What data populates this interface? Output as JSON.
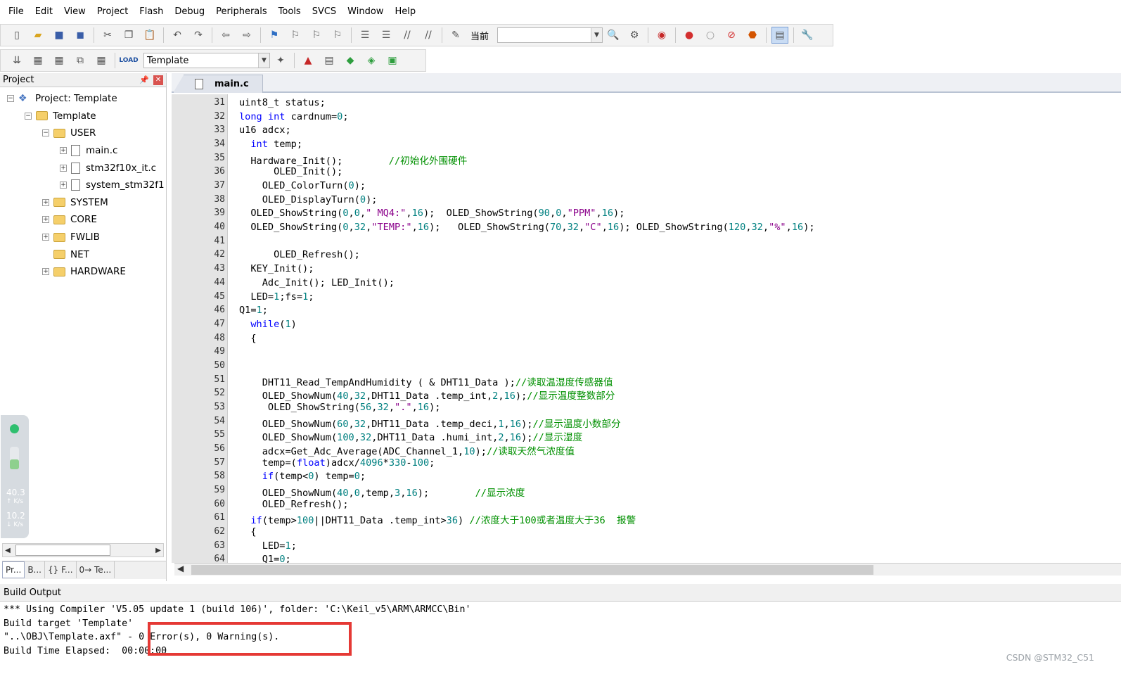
{
  "menu": [
    "File",
    "Edit",
    "View",
    "Project",
    "Flash",
    "Debug",
    "Peripherals",
    "Tools",
    "SVCS",
    "Window",
    "Help"
  ],
  "toolbar1": {
    "current_label": "当前"
  },
  "toolbar2": {
    "target_combo": "Template"
  },
  "project_panel": {
    "title": "Project",
    "tree": [
      {
        "label": "Project: Template",
        "level": 0,
        "kind": "project",
        "expander": "⊟"
      },
      {
        "label": "Template",
        "level": 1,
        "kind": "group",
        "expander": "⊟"
      },
      {
        "label": "USER",
        "level": 2,
        "kind": "folder",
        "expander": "⊟"
      },
      {
        "label": "main.c",
        "level": 3,
        "kind": "file",
        "expander": "⊞"
      },
      {
        "label": "stm32f10x_it.c",
        "level": 3,
        "kind": "file",
        "expander": "⊞"
      },
      {
        "label": "system_stm32f1",
        "level": 3,
        "kind": "file",
        "expander": "⊞"
      },
      {
        "label": "SYSTEM",
        "level": 2,
        "kind": "folder",
        "expander": "⊞"
      },
      {
        "label": "CORE",
        "level": 2,
        "kind": "folder",
        "expander": "⊞"
      },
      {
        "label": "FWLIB",
        "level": 2,
        "kind": "folder",
        "expander": "⊞"
      },
      {
        "label": "NET",
        "level": 2,
        "kind": "folder",
        "expander": ""
      },
      {
        "label": "HARDWARE",
        "level": 2,
        "kind": "folder",
        "expander": "⊞"
      }
    ],
    "tabs": [
      "Pr...",
      "B...",
      "{} F...",
      "0→ Te..."
    ]
  },
  "net_widget": {
    "up_value": "40.3",
    "up_unit": "↑ K/s",
    "down_value": "10.2",
    "down_unit": "↓ K/s"
  },
  "editor": {
    "tab_label": "main.c",
    "fold_lines": [
      48,
      62
    ],
    "lines": [
      {
        "n": 31,
        "indent": 0,
        "tokens": [
          [
            "uint8_t status;",
            ""
          ]
        ]
      },
      {
        "n": 32,
        "indent": 0,
        "tokens": [
          [
            "long int",
            "kw"
          ],
          [
            " cardnum=",
            ""
          ],
          [
            "0",
            "num"
          ],
          [
            ";",
            ""
          ]
        ]
      },
      {
        "n": 33,
        "indent": 0,
        "tokens": [
          [
            "u16 adcx;",
            ""
          ]
        ]
      },
      {
        "n": 34,
        "indent": 2,
        "tokens": [
          [
            "int",
            "kw"
          ],
          [
            " temp;",
            ""
          ]
        ]
      },
      {
        "n": 35,
        "indent": 2,
        "tokens": [
          [
            "Hardware_Init();        ",
            ""
          ],
          [
            "//初始化外围硬件",
            "cmt"
          ]
        ]
      },
      {
        "n": 36,
        "indent": 6,
        "tokens": [
          [
            "OLED_Init();",
            ""
          ]
        ]
      },
      {
        "n": 37,
        "indent": 4,
        "tokens": [
          [
            "OLED_ColorTurn(",
            ""
          ],
          [
            "0",
            "num"
          ],
          [
            ");",
            ""
          ]
        ]
      },
      {
        "n": 38,
        "indent": 4,
        "tokens": [
          [
            "OLED_DisplayTurn(",
            ""
          ],
          [
            "0",
            "num"
          ],
          [
            ");",
            ""
          ]
        ]
      },
      {
        "n": 39,
        "indent": 2,
        "tokens": [
          [
            "OLED_ShowString(",
            ""
          ],
          [
            "0",
            "num"
          ],
          [
            ",",
            ""
          ],
          [
            "0",
            "num"
          ],
          [
            ",",
            ""
          ],
          [
            "\" MQ4:\"",
            "str"
          ],
          [
            ",",
            ""
          ],
          [
            "16",
            "num"
          ],
          [
            ");  OLED_ShowString(",
            ""
          ],
          [
            "90",
            "num"
          ],
          [
            ",",
            ""
          ],
          [
            "0",
            "num"
          ],
          [
            ",",
            ""
          ],
          [
            "\"PPM\"",
            "str"
          ],
          [
            ",",
            ""
          ],
          [
            "16",
            "num"
          ],
          [
            ");",
            ""
          ]
        ]
      },
      {
        "n": 40,
        "indent": 2,
        "tokens": [
          [
            "OLED_ShowString(",
            ""
          ],
          [
            "0",
            "num"
          ],
          [
            ",",
            ""
          ],
          [
            "32",
            "num"
          ],
          [
            ",",
            ""
          ],
          [
            "\"TEMP:\"",
            "str"
          ],
          [
            ",",
            ""
          ],
          [
            "16",
            "num"
          ],
          [
            ");   OLED_ShowString(",
            ""
          ],
          [
            "70",
            "num"
          ],
          [
            ",",
            ""
          ],
          [
            "32",
            "num"
          ],
          [
            ",",
            ""
          ],
          [
            "\"C\"",
            "str"
          ],
          [
            ",",
            ""
          ],
          [
            "16",
            "num"
          ],
          [
            "); OLED_ShowString(",
            ""
          ],
          [
            "120",
            "num"
          ],
          [
            ",",
            ""
          ],
          [
            "32",
            "num"
          ],
          [
            ",",
            ""
          ],
          [
            "\"%\"",
            "str"
          ],
          [
            ",",
            ""
          ],
          [
            "16",
            "num"
          ],
          [
            ");",
            ""
          ]
        ]
      },
      {
        "n": 41,
        "indent": 0,
        "tokens": []
      },
      {
        "n": 42,
        "indent": 6,
        "tokens": [
          [
            "OLED_Refresh();",
            ""
          ]
        ]
      },
      {
        "n": 43,
        "indent": 2,
        "tokens": [
          [
            "KEY_Init();",
            ""
          ]
        ]
      },
      {
        "n": 44,
        "indent": 4,
        "tokens": [
          [
            "Adc_Init(); LED_Init();",
            ""
          ]
        ]
      },
      {
        "n": 45,
        "indent": 2,
        "tokens": [
          [
            "LED=",
            ""
          ],
          [
            "1",
            "num"
          ],
          [
            ";fs=",
            ""
          ],
          [
            "1",
            "num"
          ],
          [
            ";",
            ""
          ]
        ]
      },
      {
        "n": 46,
        "indent": 0,
        "tokens": [
          [
            "Q1=",
            ""
          ],
          [
            "1",
            "num"
          ],
          [
            ";",
            ""
          ]
        ]
      },
      {
        "n": 47,
        "indent": 2,
        "tokens": [
          [
            "while",
            "kw"
          ],
          [
            "(",
            ""
          ],
          [
            "1",
            "num"
          ],
          [
            ")",
            ""
          ]
        ]
      },
      {
        "n": 48,
        "indent": 2,
        "tokens": [
          [
            "{",
            ""
          ]
        ]
      },
      {
        "n": 49,
        "indent": 0,
        "tokens": []
      },
      {
        "n": 50,
        "indent": 0,
        "tokens": []
      },
      {
        "n": 51,
        "indent": 4,
        "tokens": [
          [
            "DHT11_Read_TempAndHumidity ( & DHT11_Data );",
            ""
          ],
          [
            "//读取温湿度传感器值",
            "cmt"
          ]
        ]
      },
      {
        "n": 52,
        "indent": 4,
        "tokens": [
          [
            "OLED_ShowNum(",
            ""
          ],
          [
            "40",
            "num"
          ],
          [
            ",",
            ""
          ],
          [
            "32",
            "num"
          ],
          [
            ",DHT11_Data .temp_int,",
            ""
          ],
          [
            "2",
            "num"
          ],
          [
            ",",
            ""
          ],
          [
            "16",
            "num"
          ],
          [
            ");",
            ""
          ],
          [
            "//显示温度整数部分",
            "cmt"
          ]
        ]
      },
      {
        "n": 53,
        "indent": 5,
        "tokens": [
          [
            "OLED_ShowString(",
            ""
          ],
          [
            "56",
            "num"
          ],
          [
            ",",
            ""
          ],
          [
            "32",
            "num"
          ],
          [
            ",",
            ""
          ],
          [
            "\".\"",
            "str"
          ],
          [
            ",",
            ""
          ],
          [
            "16",
            "num"
          ],
          [
            ");",
            ""
          ]
        ]
      },
      {
        "n": 54,
        "indent": 4,
        "tokens": [
          [
            "OLED_ShowNum(",
            ""
          ],
          [
            "60",
            "num"
          ],
          [
            ",",
            ""
          ],
          [
            "32",
            "num"
          ],
          [
            ",DHT11_Data .temp_deci,",
            ""
          ],
          [
            "1",
            "num"
          ],
          [
            ",",
            ""
          ],
          [
            "16",
            "num"
          ],
          [
            ");",
            ""
          ],
          [
            "//显示温度小数部分",
            "cmt"
          ]
        ]
      },
      {
        "n": 55,
        "indent": 4,
        "tokens": [
          [
            "OLED_ShowNum(",
            ""
          ],
          [
            "100",
            "num"
          ],
          [
            ",",
            ""
          ],
          [
            "32",
            "num"
          ],
          [
            ",DHT11_Data .humi_int,",
            ""
          ],
          [
            "2",
            "num"
          ],
          [
            ",",
            ""
          ],
          [
            "16",
            "num"
          ],
          [
            ");",
            ""
          ],
          [
            "//显示湿度",
            "cmt"
          ]
        ]
      },
      {
        "n": 56,
        "indent": 4,
        "tokens": [
          [
            "adcx=Get_Adc_Average(ADC_Channel_1,",
            ""
          ],
          [
            "10",
            "num"
          ],
          [
            ");",
            ""
          ],
          [
            "//读取天然气浓度值",
            "cmt"
          ]
        ]
      },
      {
        "n": 57,
        "indent": 4,
        "tokens": [
          [
            "temp=(",
            ""
          ],
          [
            "float",
            "kw"
          ],
          [
            ")adcx/",
            ""
          ],
          [
            "4096",
            "num"
          ],
          [
            "*",
            ""
          ],
          [
            "330",
            "num"
          ],
          [
            "-",
            ""
          ],
          [
            "100",
            "num"
          ],
          [
            ";",
            ""
          ]
        ]
      },
      {
        "n": 58,
        "indent": 4,
        "tokens": [
          [
            "if",
            "kw"
          ],
          [
            "(temp<",
            ""
          ],
          [
            "0",
            "num"
          ],
          [
            ") temp=",
            ""
          ],
          [
            "0",
            "num"
          ],
          [
            ";",
            ""
          ]
        ]
      },
      {
        "n": 59,
        "indent": 4,
        "tokens": [
          [
            "OLED_ShowNum(",
            ""
          ],
          [
            "40",
            "num"
          ],
          [
            ",",
            ""
          ],
          [
            "0",
            "num"
          ],
          [
            ",temp,",
            ""
          ],
          [
            "3",
            "num"
          ],
          [
            ",",
            ""
          ],
          [
            "16",
            "num"
          ],
          [
            ");        ",
            ""
          ],
          [
            "//显示浓度",
            "cmt"
          ]
        ]
      },
      {
        "n": 60,
        "indent": 4,
        "tokens": [
          [
            "OLED_Refresh();",
            ""
          ]
        ]
      },
      {
        "n": 61,
        "indent": 2,
        "tokens": [
          [
            "if",
            "kw"
          ],
          [
            "(temp>",
            ""
          ],
          [
            "100",
            "num"
          ],
          [
            "||DHT11_Data .temp_int>",
            ""
          ],
          [
            "36",
            "num"
          ],
          [
            ") ",
            ""
          ],
          [
            "//浓度大于100或者温度大于36  报警",
            "cmt"
          ]
        ]
      },
      {
        "n": 62,
        "indent": 2,
        "tokens": [
          [
            "{",
            ""
          ]
        ]
      },
      {
        "n": 63,
        "indent": 4,
        "tokens": [
          [
            "LED=",
            ""
          ],
          [
            "1",
            "num"
          ],
          [
            ";",
            ""
          ]
        ]
      },
      {
        "n": 64,
        "indent": 4,
        "tokens": [
          [
            "Q1=",
            ""
          ],
          [
            "0",
            "num"
          ],
          [
            ";",
            ""
          ]
        ]
      }
    ]
  },
  "build_output": {
    "title": "Build Output",
    "lines": [
      "*** Using Compiler 'V5.05 update 1 (build 106)', folder: 'C:\\Keil_v5\\ARM\\ARMCC\\Bin'",
      "Build target 'Template'",
      "\"..\\OBJ\\Template.axf\" - 0 Error(s), 0 Warning(s).",
      "Build Time Elapsed:  00:00:00"
    ],
    "highlight_color": "#e53935"
  },
  "watermark": "CSDN @STM32_C51"
}
